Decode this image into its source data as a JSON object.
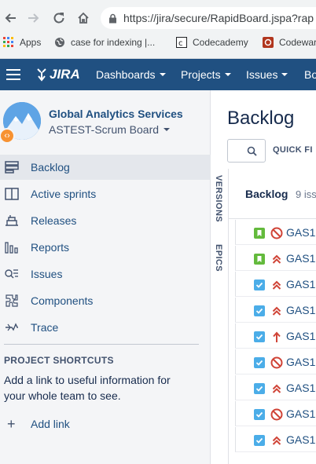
{
  "browser": {
    "url": "https://jira/secure/RapidBoard.jspa?rap",
    "bookmarks": [
      {
        "label": "Apps",
        "icon": "apps-grid-icon"
      },
      {
        "label": "case for indexing |...",
        "icon": "globe-icon"
      },
      {
        "label": "Codecademy",
        "icon": "codecademy-icon"
      },
      {
        "label": "Codewar",
        "icon": "codewars-icon"
      }
    ]
  },
  "header": {
    "logo": "JIRA",
    "menus": [
      "Dashboards",
      "Projects",
      "Issues",
      "Bo"
    ]
  },
  "sidebar": {
    "project_name": "Global Analytics Services",
    "board_name": "ASTEST-Scrum Board",
    "items": [
      {
        "label": "Backlog",
        "icon": "backlog-icon",
        "active": true
      },
      {
        "label": "Active sprints",
        "icon": "active-sprints-icon"
      },
      {
        "label": "Releases",
        "icon": "releases-icon"
      },
      {
        "label": "Reports",
        "icon": "reports-icon"
      },
      {
        "label": "Issues",
        "icon": "issues-icon"
      },
      {
        "label": "Components",
        "icon": "components-icon"
      },
      {
        "label": "Trace",
        "icon": "trace-icon"
      }
    ],
    "shortcuts_title": "PROJECT SHORTCUTS",
    "shortcuts_text": "Add a link to useful information for your whole team to see.",
    "add_link": "Add link"
  },
  "main": {
    "title": "Backlog",
    "quick_filters": "QUICK FI",
    "tabs": [
      "VERSIONS",
      "EPICS"
    ],
    "backlog_title": "Backlog",
    "backlog_count": "9 iss",
    "issues": [
      {
        "key": "GAS1-",
        "type": "story",
        "priority": "blocker"
      },
      {
        "key": "GAS1-",
        "type": "story",
        "priority": "critical"
      },
      {
        "key": "GAS1-",
        "type": "task",
        "priority": "critical"
      },
      {
        "key": "GAS1-",
        "type": "task",
        "priority": "critical"
      },
      {
        "key": "GAS1-",
        "type": "task",
        "priority": "highest"
      },
      {
        "key": "GAS1-",
        "type": "task",
        "priority": "blocker"
      },
      {
        "key": "GAS1-",
        "type": "task",
        "priority": "critical"
      },
      {
        "key": "GAS1-",
        "type": "task",
        "priority": "blocker"
      },
      {
        "key": "GAS1-",
        "type": "task",
        "priority": "critical"
      }
    ]
  },
  "colors": {
    "header_bg": "#205081",
    "link": "#205081",
    "story": "#63ba3c",
    "task": "#4bade8",
    "priority_red": "#d04437",
    "project_badge": "#f79232"
  }
}
